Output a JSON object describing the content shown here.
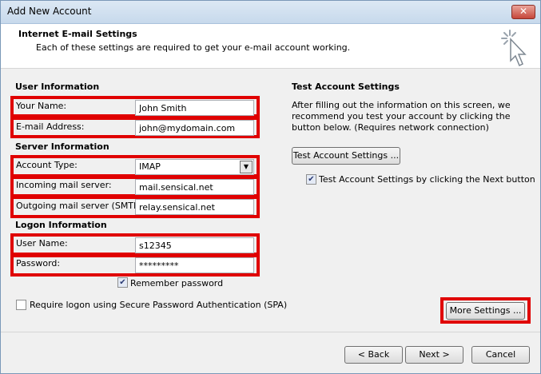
{
  "window": {
    "title": "Add New Account",
    "close_glyph": "✕"
  },
  "header": {
    "title": "Internet E-mail Settings",
    "subtitle": "Each of these settings are required to get your e-mail account working."
  },
  "user_info": {
    "section_title": "User Information",
    "name_label": "Your Name:",
    "name_value": "John Smith",
    "email_label": "E-mail Address:",
    "email_value": "john@mydomain.com"
  },
  "server_info": {
    "section_title": "Server Information",
    "account_type_label": "Account Type:",
    "account_type_value": "IMAP",
    "incoming_label": "Incoming mail server:",
    "incoming_value": "mail.sensical.net",
    "outgoing_label": "Outgoing mail server (SMTP):",
    "outgoing_value": "relay.sensical.net"
  },
  "logon_info": {
    "section_title": "Logon Information",
    "username_label": "User Name:",
    "username_value": "s12345",
    "password_label": "Password:",
    "password_value": "*********",
    "remember_label": "Remember password",
    "remember_checked": true,
    "spa_label": "Require logon using Secure Password Authentication (SPA)",
    "spa_checked": false
  },
  "test_settings": {
    "section_title": "Test Account Settings",
    "description": "After filling out the information on this screen, we recommend you test your account by clicking the button below. (Requires network connection)",
    "test_button_label": "Test Account Settings ...",
    "next_checkbox_label": "Test Account Settings by clicking the Next button",
    "next_checkbox_checked": true
  },
  "more_settings_label": "More Settings ...",
  "footer": {
    "back_label": "< Back",
    "next_label": "Next >",
    "cancel_label": "Cancel"
  },
  "icons": {
    "check_glyph": "✔",
    "dropdown_glyph": "▼",
    "header_icon": "magic-wand-cursor-icon"
  },
  "colors": {
    "highlight": "#e00000"
  }
}
